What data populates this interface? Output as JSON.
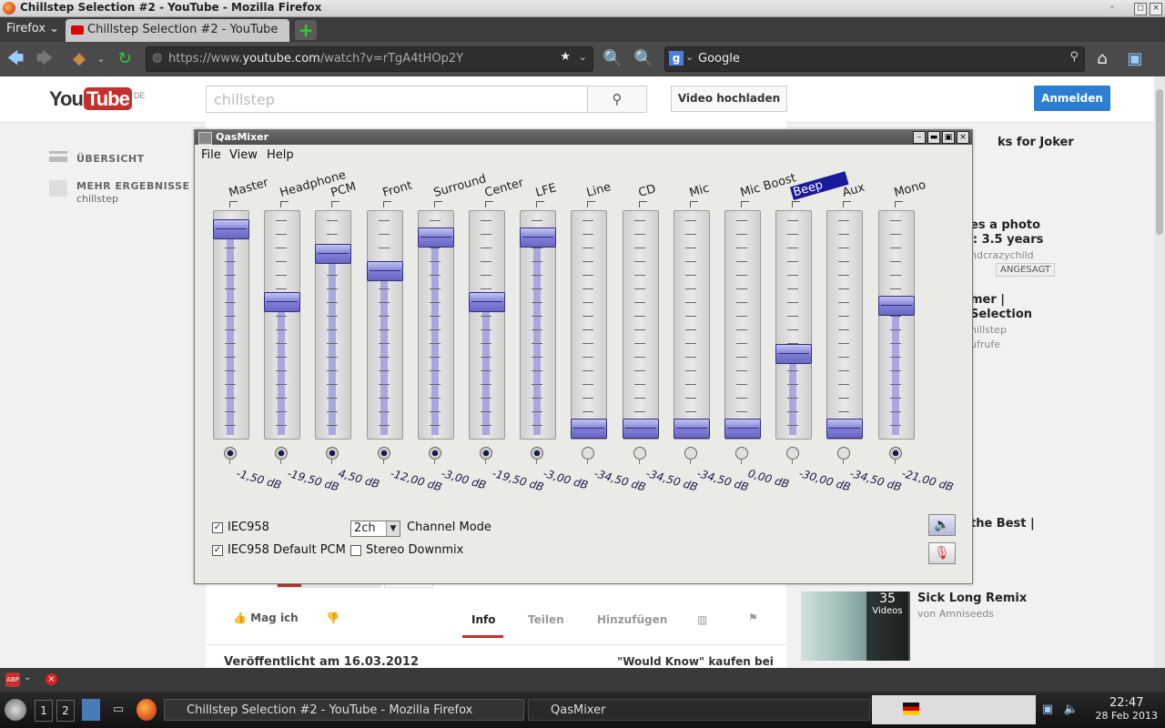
{
  "window": {
    "title": "Chillstep Selection #2 - YouTube - Mozilla Firefox"
  },
  "firefox": {
    "menu_label": "Firefox",
    "tab_label": "Chillstep Selection #2 - YouTube",
    "url_prefix": "https://www.",
    "url_domain": "youtube.com",
    "url_rest": "/watch?v=rTgA4tHOp2Y",
    "search_engine": "Google"
  },
  "youtube": {
    "logo_you": "You",
    "logo_tube": "Tube",
    "logo_region": "DE",
    "search_value": "chillstep",
    "upload_label": "Video hochladen",
    "signin_label": "Anmelden",
    "guide": [
      {
        "label": "ÜBERSICHT",
        "sub": ""
      },
      {
        "label": "MEHR ERGEBNISSE",
        "sub": "chillstep"
      }
    ],
    "actions": {
      "like": "Mag ich"
    },
    "tabs": [
      "Info",
      "Teilen",
      "Hinzufügen"
    ],
    "published": "Veröffentlicht am 16.03.2012",
    "buy_link": "\"Would Know\" kaufen bei",
    "sidebar": [
      {
        "title": "ks for Joker",
        "sub": ""
      },
      {
        "title": "es a photo",
        "sub": ""
      },
      {
        "title": "ay: 3.5 years",
        "sub": "ndcrazychild"
      },
      {
        "title": "mer |",
        "sub": ""
      },
      {
        "title": "Selection",
        "sub": "hillstep"
      },
      {
        "title": "Selection",
        "sub": "ufrufe"
      },
      {
        "title": "the Best |",
        "sub": ""
      },
      {
        "title": "Sick Long Remix",
        "sub": "von Amniseeds"
      }
    ],
    "watched_badge": "ANGESAGT",
    "playlist_count": "35",
    "playlist_label": "Videos"
  },
  "mixer": {
    "title": "QasMixer",
    "menu": [
      "File",
      "View",
      "Help"
    ],
    "channels": [
      {
        "name": "Master",
        "db": "-1,50 dB",
        "level": 0.96,
        "on": true
      },
      {
        "name": "Headphone",
        "db": "-19,50 dB",
        "level": 0.61,
        "on": true
      },
      {
        "name": "PCM",
        "db": "4,50 dB",
        "level": 0.84,
        "on": true
      },
      {
        "name": "Front",
        "db": "-12,00 dB",
        "level": 0.76,
        "on": true
      },
      {
        "name": "Surround",
        "db": "-3,00 dB",
        "level": 0.92,
        "on": true
      },
      {
        "name": "Center",
        "db": "-19,50 dB",
        "level": 0.61,
        "on": true
      },
      {
        "name": "LFE",
        "db": "-3,00 dB",
        "level": 0.92,
        "on": true
      },
      {
        "name": "Line",
        "db": "-34,50 dB",
        "level": 0.0,
        "on": false
      },
      {
        "name": "CD",
        "db": "-34,50 dB",
        "level": 0.0,
        "on": false
      },
      {
        "name": "Mic",
        "db": "-34,50 dB",
        "level": 0.0,
        "on": false
      },
      {
        "name": "Mic Boost",
        "db": "0,00 dB",
        "level": 0.0,
        "on": false
      },
      {
        "name": "Beep",
        "db": "-30,00 dB",
        "level": 0.36,
        "on": false
      },
      {
        "name": "Aux",
        "db": "-34,50 dB",
        "level": 0.0,
        "on": false
      },
      {
        "name": "Mono",
        "db": "-21,00 dB",
        "level": 0.59,
        "on": true
      }
    ],
    "selected_channel": "Beep",
    "options": {
      "iec958": "IEC958",
      "iec958_default": "IEC958 Default PCM",
      "channel_mode_value": "2ch",
      "channel_mode_label": "Channel Mode",
      "stereo_downmix": "Stereo Downmix"
    }
  },
  "taskbar": {
    "workspaces": [
      "1",
      "2"
    ],
    "tasks": [
      "Chillstep Selection #2 - YouTube - Mozilla Firefox",
      "QasMixer"
    ],
    "time": "22:47",
    "date": "28 Feb 2013"
  }
}
